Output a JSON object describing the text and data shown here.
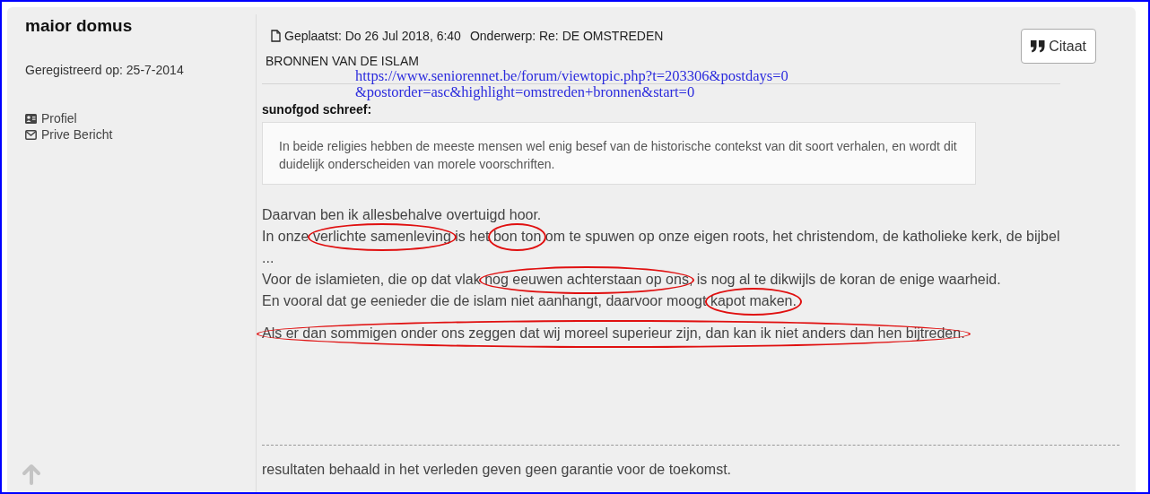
{
  "author": {
    "name": "maior domus",
    "registered": "Geregistreerd op: 25-7-2014",
    "links": [
      {
        "label": "Profiel",
        "kind": "profile"
      },
      {
        "label": "Prive Bericht",
        "kind": "message"
      }
    ]
  },
  "post": {
    "posted": "Geplaatst: Do 26 Jul 2018, 6:40",
    "subject": "Onderwerp: Re: DE OMSTREDEN",
    "subject_cont": "BRONNEN VAN DE ISLAM",
    "url_lines": [
      "https://www.seniorennet.be/forum/viewtopic.php?t=203306&postdays=0",
      "&postorder=asc&highlight=omstreden+bronnen&start=0"
    ],
    "quote_button": "Citaat",
    "quote": {
      "author": "sunofgod schreef:",
      "text": "In beide religies hebben de meeste mensen wel enig besef van de historische contekst van dit soort verhalen, en wordt dit duidelijk onderscheiden van morele voorschriften."
    },
    "paragraphs": [
      {
        "lines": [
          [
            {
              "text": "Daarvan ben ik allesbehalve overtuigd hoor.",
              "circled": false
            }
          ],
          [
            {
              "text": "In onze ",
              "circled": false
            },
            {
              "text": "verlichte samenleving",
              "circled": true
            },
            {
              "text": " is het ",
              "circled": false
            },
            {
              "text": "bon ton",
              "circled": true
            },
            {
              "text": " om te spuwen op onze eigen roots, het christendom, de katholieke kerk, de bijbel",
              "circled": false
            }
          ],
          [
            {
              "text": "...",
              "circled": false
            }
          ],
          [
            {
              "text": "Voor de islamieten, die op dat vlak ",
              "circled": false
            },
            {
              "text": "nog eeuwen achterstaan op ons",
              "circled": true
            },
            {
              "text": ", is nog al te dikwijls de koran de enige waarheid.",
              "circled": false
            }
          ],
          [
            {
              "text": "En vooral dat ge eenieder die de islam niet aanhangt, daarvoor moogt ",
              "circled": false
            },
            {
              "text": "kapot maken.",
              "circled": true
            }
          ]
        ]
      },
      {
        "lines": [
          [
            {
              "text": "Als er dan sommigen onder ons zeggen dat wij moreel superieur zijn, dan kan ik niet anders dan hen bijtreden.",
              "circled": true
            }
          ]
        ]
      }
    ],
    "signature": "resultaten behaald in het verleden geven geen garantie voor de toekomst."
  }
}
